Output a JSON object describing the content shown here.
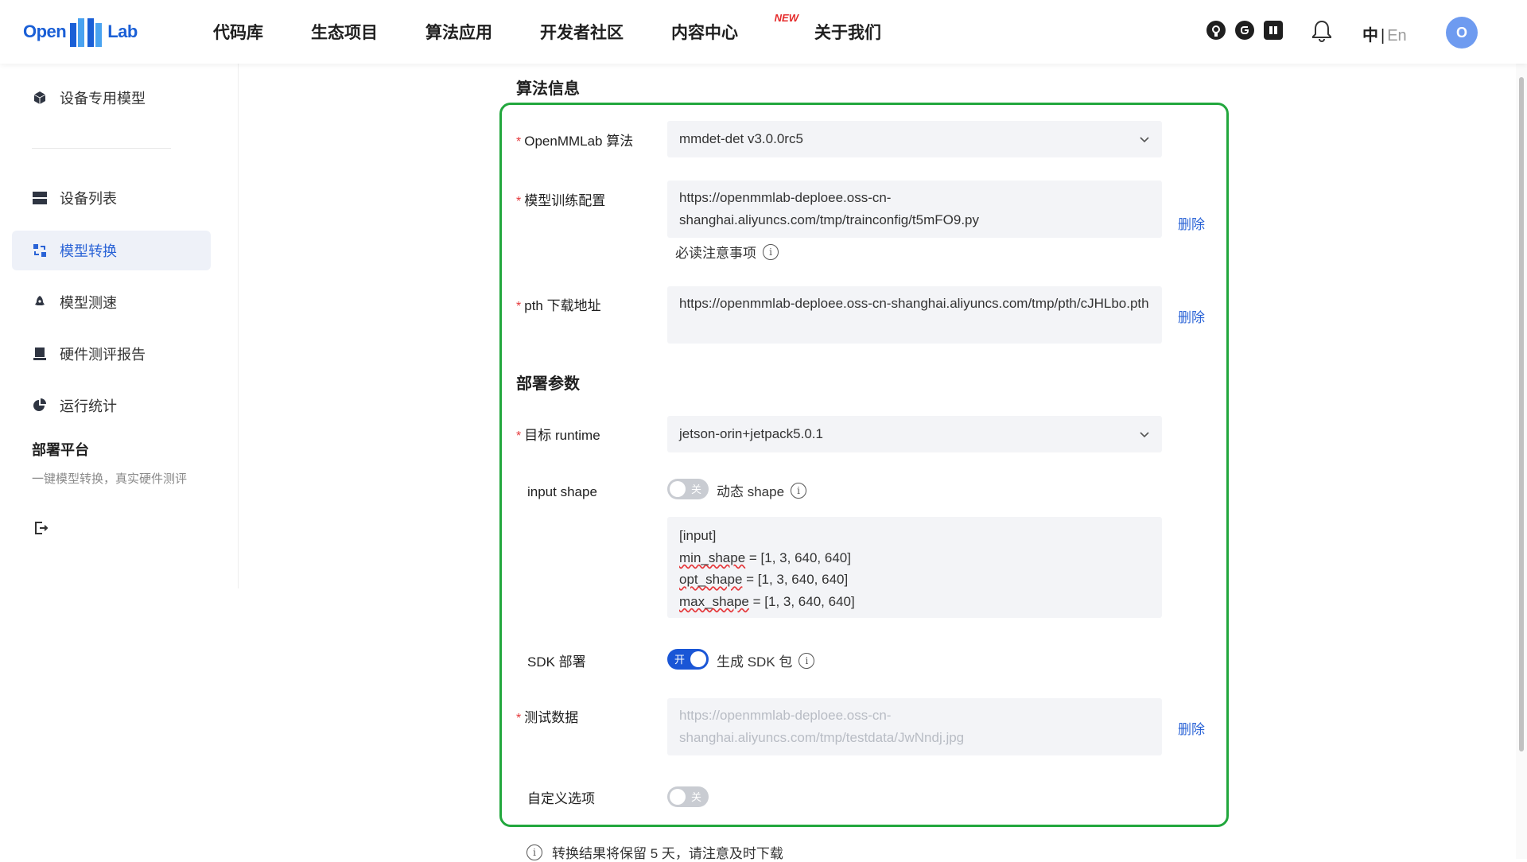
{
  "header": {
    "logo": {
      "left": "Open",
      "right": "Lab"
    },
    "nav": [
      "代码库",
      "生态项目",
      "算法应用",
      "开发者社区",
      "内容中心",
      "关于我们"
    ],
    "new_badge": "NEW",
    "icons": [
      "github-icon",
      "gitee-icon",
      "bilibili-icon",
      "bell-icon"
    ],
    "lang_zh": "中",
    "lang_sep": "|",
    "lang_en": "En",
    "avatar_initial": "O"
  },
  "sidebar": {
    "top_item": "设备专用模型",
    "items": [
      "设备列表",
      "模型转换",
      "模型测速",
      "硬件测评报告",
      "运行统计"
    ],
    "active_index": 1,
    "title": "部署平台",
    "subtitle": "一键模型转换，真实硬件测评"
  },
  "form": {
    "section1_title": "算法信息",
    "section2_title": "部署参数",
    "required_mark": "*",
    "algo_label": "OpenMMLab 算法",
    "algo_value": "mmdet-det v3.0.0rc5",
    "train_config_label": "模型训练配置",
    "train_config_value": "https://openmmlab-deploee.oss-cn-shanghai.aliyuncs.com/tmp/trainconfig/t5mFO9.py",
    "train_config_note": "必读注意事项",
    "pth_label": "pth 下载地址",
    "pth_value": "https://openmmlab-deploee.oss-cn-shanghai.aliyuncs.com/tmp/pth/cJHLbo.pth",
    "runtime_label": "目标 runtime",
    "runtime_value": "jetson-orin+jetpack5.0.1",
    "input_shape_label": "input shape",
    "dynamic_toggle": {
      "state_label": "关",
      "on": false,
      "text": "动态 shape"
    },
    "input_shape_lines": {
      "header": "[input]",
      "min_key": "min_shape",
      "min_val": " = [1, 3, 640, 640]",
      "opt_key": "opt_shape",
      "opt_val": " = [1, 3, 640, 640]",
      "max_key": "max_shape",
      "max_val": " = [1, 3, 640, 640]"
    },
    "sdk_label": "SDK 部署",
    "sdk_toggle": {
      "state_label": "开",
      "on": true,
      "text": "生成 SDK 包"
    },
    "test_data_label": "测试数据",
    "test_data_value": "https://openmmlab-deploee.oss-cn-shanghai.aliyuncs.com/tmp/testdata/JwNndj.jpg",
    "custom_label": "自定义选项",
    "custom_toggle": {
      "state_label": "关",
      "on": false
    },
    "delete_label": "删除",
    "footer_note": "转换结果将保留 5 天，请注意及时下载"
  },
  "colors": {
    "accent": "#2a63d6",
    "highlight_border": "#22a73d",
    "required": "#e5383b",
    "new_badge": "#e52b2b"
  }
}
